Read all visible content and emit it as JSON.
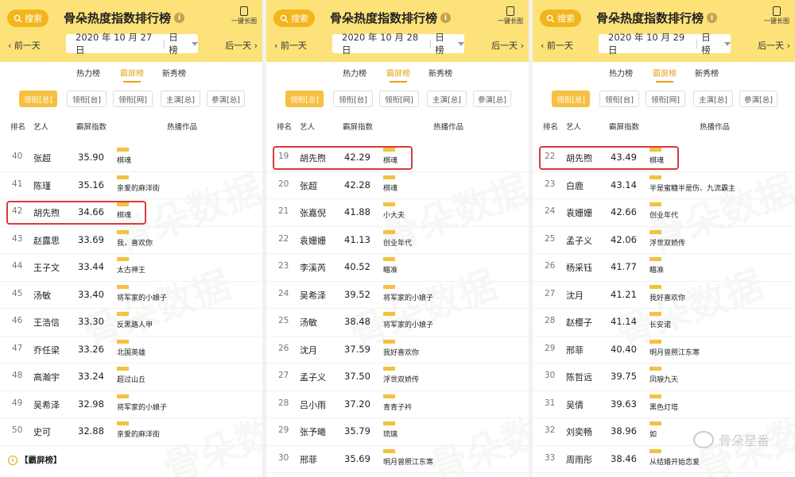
{
  "app": {
    "search_label": "搜索",
    "title": "骨朵热度指数排行榜",
    "long_image_label": "一键长图",
    "prev_label": "前一天",
    "next_label": "后一天",
    "period_label": "日榜"
  },
  "tabs": [
    "热力榜",
    "霸屏榜",
    "新秀榜"
  ],
  "active_tab": "霸屏榜",
  "filters": [
    "领衔[总]",
    "领衔[台]",
    "领衔[网]",
    "主演[总]",
    "参演[总]"
  ],
  "active_filter": "领衔[总]",
  "columns": {
    "rank": "排名",
    "artist": "艺人",
    "index": "霸屏指数",
    "works": "热播作品"
  },
  "panels": [
    {
      "date": "2020 年 10 月 27 日",
      "rows": [
        {
          "rank": "40",
          "name": "张超",
          "index": "35.90",
          "work": "棋魂"
        },
        {
          "rank": "41",
          "name": "陈瑾",
          "index": "35.16",
          "work": "亲爱的麻洋街"
        },
        {
          "rank": "42",
          "name": "胡先煦",
          "index": "34.66",
          "work": "棋魂",
          "highlight": true
        },
        {
          "rank": "43",
          "name": "赵露思",
          "index": "33.69",
          "work": "我，喜欢你"
        },
        {
          "rank": "44",
          "name": "王子文",
          "index": "33.44",
          "work": "太古神王"
        },
        {
          "rank": "45",
          "name": "汤敏",
          "index": "33.40",
          "work": "将军家的小娘子"
        },
        {
          "rank": "46",
          "name": "王浩信",
          "index": "33.30",
          "work": "反黑路人甲"
        },
        {
          "rank": "47",
          "name": "乔任梁",
          "index": "33.26",
          "work": "北国英雄"
        },
        {
          "rank": "48",
          "name": "高瀚宇",
          "index": "33.24",
          "work": "超过山丘"
        },
        {
          "rank": "49",
          "name": "吴希泽",
          "index": "32.98",
          "work": "将军家的小娘子"
        },
        {
          "rank": "50",
          "name": "史可",
          "index": "32.88",
          "work": "亲爱的麻洋街"
        }
      ]
    },
    {
      "date": "2020 年 10 月 28 日",
      "rows": [
        {
          "rank": "19",
          "name": "胡先煦",
          "index": "42.29",
          "work": "棋魂",
          "highlight": true
        },
        {
          "rank": "20",
          "name": "张超",
          "index": "42.28",
          "work": "棋魂"
        },
        {
          "rank": "21",
          "name": "张嘉倪",
          "index": "41.88",
          "work": "小大夫"
        },
        {
          "rank": "22",
          "name": "袁姗姗",
          "index": "41.13",
          "work": "创业年代"
        },
        {
          "rank": "23",
          "name": "李溪芮",
          "index": "40.52",
          "work": "瞄准"
        },
        {
          "rank": "24",
          "name": "吴希泽",
          "index": "39.52",
          "work": "将军家的小娘子"
        },
        {
          "rank": "25",
          "name": "汤敏",
          "index": "38.48",
          "work": "将军家的小娘子"
        },
        {
          "rank": "26",
          "name": "沈月",
          "index": "37.59",
          "work": "我好喜欢你"
        },
        {
          "rank": "27",
          "name": "孟子义",
          "index": "37.50",
          "work": "浮世双娇传"
        },
        {
          "rank": "28",
          "name": "吕小雨",
          "index": "37.20",
          "work": "青青子衿"
        },
        {
          "rank": "29",
          "name": "张予曦",
          "index": "35.79",
          "work": "琉璃"
        },
        {
          "rank": "30",
          "name": "邢菲",
          "index": "35.69",
          "work": "明月曾照江东寒"
        }
      ]
    },
    {
      "date": "2020 年 10 月 29 日",
      "rows": [
        {
          "rank": "22",
          "name": "胡先煦",
          "index": "43.49",
          "work": "棋魂",
          "highlight": true
        },
        {
          "rank": "23",
          "name": "白鹿",
          "index": "43.14",
          "work": "半是蜜糖半是伤、九流霸主"
        },
        {
          "rank": "24",
          "name": "袁姗姗",
          "index": "42.66",
          "work": "创业年代"
        },
        {
          "rank": "25",
          "name": "孟子义",
          "index": "42.06",
          "work": "浮世双娇传"
        },
        {
          "rank": "26",
          "name": "杨采钰",
          "index": "41.77",
          "work": "瞄准"
        },
        {
          "rank": "27",
          "name": "沈月",
          "index": "41.21",
          "work": "我好喜欢你"
        },
        {
          "rank": "28",
          "name": "赵樱子",
          "index": "41.14",
          "work": "长安诺"
        },
        {
          "rank": "29",
          "name": "邢菲",
          "index": "40.40",
          "work": "明月曾照江东寒"
        },
        {
          "rank": "30",
          "name": "陈哲远",
          "index": "39.75",
          "work": "凤唳九天"
        },
        {
          "rank": "31",
          "name": "吴倩",
          "index": "39.63",
          "work": "黑色灯塔"
        },
        {
          "rank": "32",
          "name": "刘奕畅",
          "index": "38.96",
          "work": "如"
        },
        {
          "rank": "33",
          "name": "周雨彤",
          "index": "38.46",
          "work": "从结婚开始恋爱"
        }
      ]
    }
  ],
  "footer": "【霸屏榜】",
  "watermark": "骨朵数据",
  "brand": "骨朵星番",
  "colors": {
    "header_bg": "#fde27a",
    "accent": "#e7a316",
    "bar": "#f4c141",
    "highlight_border": "#d63b3b"
  }
}
